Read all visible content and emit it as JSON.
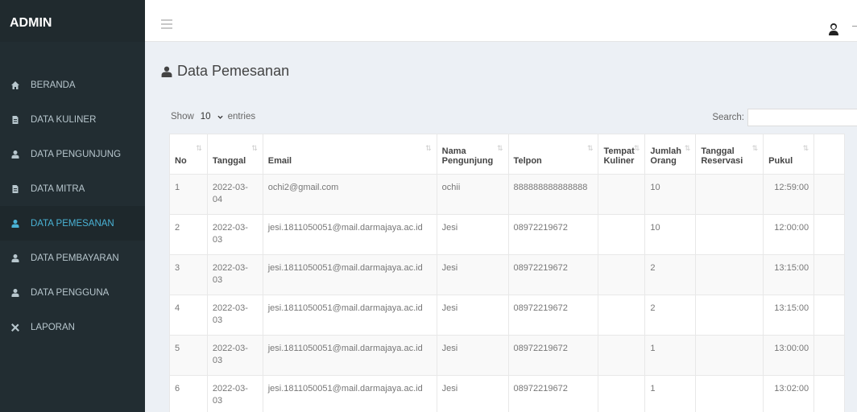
{
  "brand": "ADMIN",
  "sidebar": {
    "items": [
      {
        "label": "BERANDA",
        "icon": "home-icon"
      },
      {
        "label": "DATA KULINER",
        "icon": "file-icon"
      },
      {
        "label": "DATA PENGUNJUNG",
        "icon": "user-icon"
      },
      {
        "label": "DATA MITRA",
        "icon": "file-icon"
      },
      {
        "label": "DATA PEMESANAN",
        "icon": "user-icon",
        "active": true
      },
      {
        "label": "DATA PEMBAYARAN",
        "icon": "user-icon"
      },
      {
        "label": "DATA PENGGUNA",
        "icon": "user-icon"
      },
      {
        "label": "LAPORAN",
        "icon": "tools-icon"
      }
    ]
  },
  "page": {
    "title": "Data Pemesanan"
  },
  "controls": {
    "show_label": "Show",
    "entries_value": "10",
    "entries_label": "entries",
    "search_label": "Search:"
  },
  "table": {
    "headers": [
      "No",
      "Tanggal",
      "Email",
      "Nama Pengunjung",
      "Telpon",
      "Tempat Kuliner",
      "Jumlah Orang",
      "Tanggal Reservasi",
      "Pukul"
    ],
    "rows": [
      {
        "no": "1",
        "tanggal": "2022-03-04",
        "email": "ochi2@gmail.com",
        "nama": "ochii",
        "telpon": "888888888888888",
        "tempat": "",
        "jumlah": "10",
        "reservasi": "",
        "pukul": "12:59:00"
      },
      {
        "no": "2",
        "tanggal": "2022-03-03",
        "email": "jesi.1811050051@mail.darmajaya.ac.id",
        "nama": "Jesi",
        "telpon": "08972219672",
        "tempat": "",
        "jumlah": "10",
        "reservasi": "",
        "pukul": "12:00:00"
      },
      {
        "no": "3",
        "tanggal": "2022-03-03",
        "email": "jesi.1811050051@mail.darmajaya.ac.id",
        "nama": "Jesi",
        "telpon": "08972219672",
        "tempat": "",
        "jumlah": "2",
        "reservasi": "",
        "pukul": "13:15:00"
      },
      {
        "no": "4",
        "tanggal": "2022-03-03",
        "email": "jesi.1811050051@mail.darmajaya.ac.id",
        "nama": "Jesi",
        "telpon": "08972219672",
        "tempat": "",
        "jumlah": "2",
        "reservasi": "",
        "pukul": "13:15:00"
      },
      {
        "no": "5",
        "tanggal": "2022-03-03",
        "email": "jesi.1811050051@mail.darmajaya.ac.id",
        "nama": "Jesi",
        "telpon": "08972219672",
        "tempat": "",
        "jumlah": "1",
        "reservasi": "",
        "pukul": "13:00:00"
      },
      {
        "no": "6",
        "tanggal": "2022-03-03",
        "email": "jesi.1811050051@mail.darmajaya.ac.id",
        "nama": "Jesi",
        "telpon": "08972219672",
        "tempat": "",
        "jumlah": "1",
        "reservasi": "",
        "pukul": "13:02:00"
      }
    ]
  },
  "colors": {
    "sidebar_bg": "#222d32",
    "active_text": "#4ab3d6",
    "content_bg": "#ecf0f5"
  }
}
